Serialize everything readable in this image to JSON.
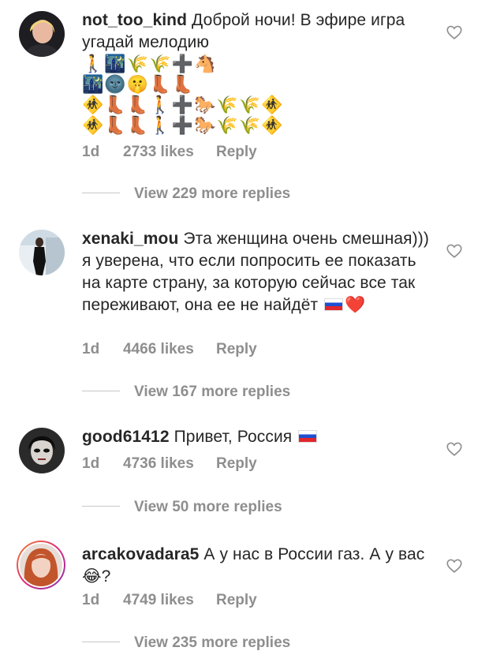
{
  "comments": [
    {
      "username": "not_too_kind",
      "text": "Доброй ночи! В эфире игра угадай мелодию",
      "emoji_lines": [
        "🚶🌃🌾🌾➕🐴",
        "🌃🌚🤫👢👢",
        "🚸👢👢🚶➕🐎🌾🌾🚸",
        "🚸👢👢🚶➕🐎🌾🌾🚸"
      ],
      "timestamp": "1d",
      "likes": "2733 likes",
      "reply_label": "Reply",
      "view_replies": "View 229 more replies"
    },
    {
      "username": "xenaki_mou",
      "text": "Эта женщина очень смешная))) я уверена, что если попросить ее показать на карте страну, за которую сейчас все так переживают, она ее не найдёт",
      "emoji_suffix": "❤️",
      "timestamp": "1d",
      "likes": "4466 likes",
      "reply_label": "Reply",
      "view_replies": "View 167 more replies"
    },
    {
      "username": "good61412",
      "text": "Привет, Россия",
      "timestamp": "1d",
      "likes": "4736 likes",
      "reply_label": "Reply",
      "view_replies": "View 50 more replies"
    },
    {
      "username": "arcakovadara5",
      "text": "А у нас в России газ. А у вас",
      "emoji_suffix": "😂?",
      "timestamp": "1d",
      "likes": "4749 likes",
      "reply_label": "Reply",
      "view_replies": "View 235 more replies"
    }
  ],
  "icons": {
    "like": "heart-outline-icon",
    "flag": "russia-flag-icon"
  },
  "colors": {
    "text": "#262626",
    "secondary": "#8e8e8e",
    "divider": "#c7c7c7"
  }
}
